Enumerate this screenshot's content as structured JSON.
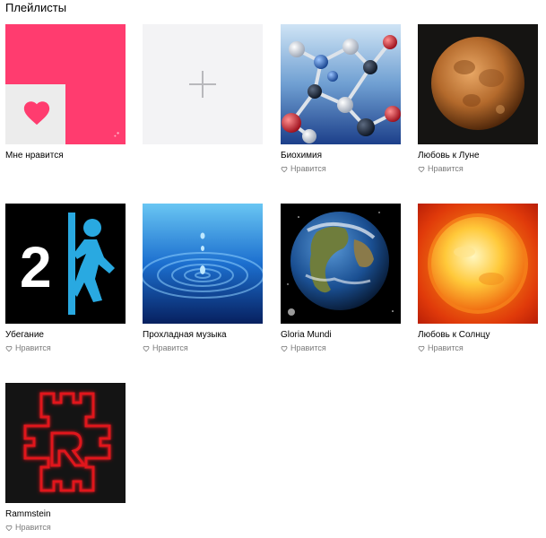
{
  "header": {
    "title": "Плейлисты"
  },
  "like_label": "Нравится",
  "playlists": [
    {
      "name": "Мне нравится",
      "icon": "heart-icon",
      "color": "#ff3c6f"
    },
    {
      "name": "",
      "icon": "plus-icon",
      "color": "#f3f3f5"
    },
    {
      "name": "Биохимия",
      "liked_label": "Нравится"
    },
    {
      "name": "Любовь к Луне",
      "liked_label": "Нравится"
    },
    {
      "name": "Убегание",
      "liked_label": "Нравится"
    },
    {
      "name": "Прохладная музыка",
      "liked_label": "Нравится"
    },
    {
      "name": "Gloria Mundi",
      "liked_label": "Нравится"
    },
    {
      "name": "Любовь к Солнцу",
      "liked_label": "Нравится"
    },
    {
      "name": "Rammstein",
      "liked_label": "Нравится"
    }
  ]
}
